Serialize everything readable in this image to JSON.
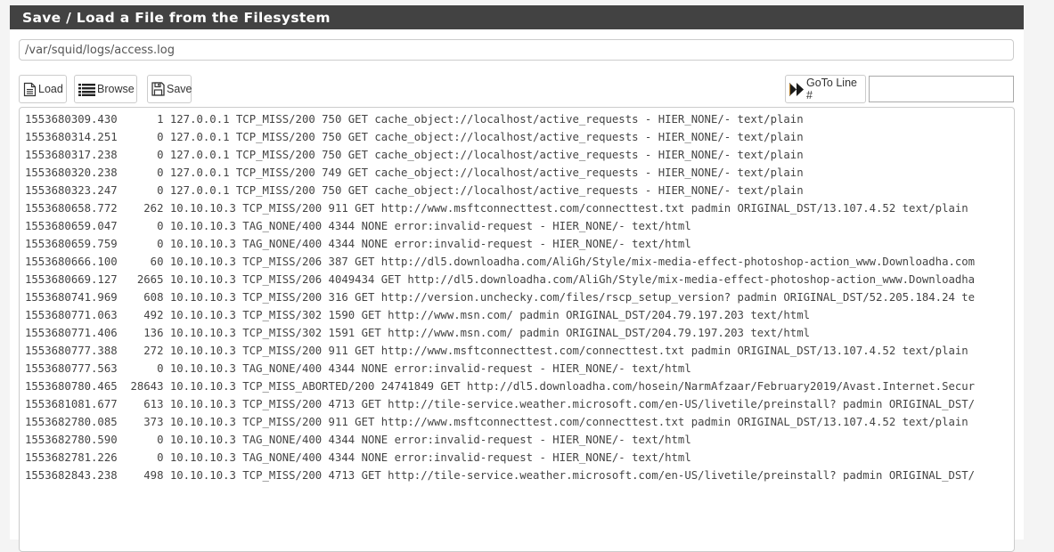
{
  "panel": {
    "title": "Save / Load a File from the Filesystem"
  },
  "file_path": {
    "value": "/var/squid/logs/access.log"
  },
  "toolbar": {
    "load_label": "Load",
    "load_icon": "file-text-icon",
    "browse_label": "Browse",
    "browse_icon": "list-icon",
    "save_label": "Save",
    "save_icon": "floppy-disk-icon",
    "goto_label": "GoTo Line #",
    "goto_icon": "fast-forward-icon",
    "goto_value": ""
  },
  "log_lines": [
    "1553680309.430      1 127.0.0.1 TCP_MISS/200 750 GET cache_object://localhost/active_requests - HIER_NONE/- text/plain",
    "1553680314.251      0 127.0.0.1 TCP_MISS/200 750 GET cache_object://localhost/active_requests - HIER_NONE/- text/plain",
    "1553680317.238      0 127.0.0.1 TCP_MISS/200 750 GET cache_object://localhost/active_requests - HIER_NONE/- text/plain",
    "1553680320.238      0 127.0.0.1 TCP_MISS/200 749 GET cache_object://localhost/active_requests - HIER_NONE/- text/plain",
    "1553680323.247      0 127.0.0.1 TCP_MISS/200 750 GET cache_object://localhost/active_requests - HIER_NONE/- text/plain",
    "1553680658.772    262 10.10.10.3 TCP_MISS/200 911 GET http://www.msftconnecttest.com/connecttest.txt padmin ORIGINAL_DST/13.107.4.52 text/plain",
    "1553680659.047      0 10.10.10.3 TAG_NONE/400 4344 NONE error:invalid-request - HIER_NONE/- text/html",
    "1553680659.759      0 10.10.10.3 TAG_NONE/400 4344 NONE error:invalid-request - HIER_NONE/- text/html",
    "1553680666.100     60 10.10.10.3 TCP_MISS/206 387 GET http://dl5.downloadha.com/AliGh/Style/mix-media-effect-photoshop-action_www.Downloadha.com",
    "1553680669.127   2665 10.10.10.3 TCP_MISS/206 4049434 GET http://dl5.downloadha.com/AliGh/Style/mix-media-effect-photoshop-action_www.Downloadha",
    "1553680741.969    608 10.10.10.3 TCP_MISS/200 316 GET http://version.unchecky.com/files/rscp_setup_version? padmin ORIGINAL_DST/52.205.184.24 te",
    "1553680771.063    492 10.10.10.3 TCP_MISS/302 1590 GET http://www.msn.com/ padmin ORIGINAL_DST/204.79.197.203 text/html",
    "1553680771.406    136 10.10.10.3 TCP_MISS/302 1591 GET http://www.msn.com/ padmin ORIGINAL_DST/204.79.197.203 text/html",
    "1553680777.388    272 10.10.10.3 TCP_MISS/200 911 GET http://www.msftconnecttest.com/connecttest.txt padmin ORIGINAL_DST/13.107.4.52 text/plain",
    "1553680777.563      0 10.10.10.3 TAG_NONE/400 4344 NONE error:invalid-request - HIER_NONE/- text/html",
    "1553680780.465  28643 10.10.10.3 TCP_MISS_ABORTED/200 24741849 GET http://dl5.downloadha.com/hosein/NarmAfzaar/February2019/Avast.Internet.Secur",
    "1553681081.677    613 10.10.10.3 TCP_MISS/200 4713 GET http://tile-service.weather.microsoft.com/en-US/livetile/preinstall? padmin ORIGINAL_DST/",
    "1553682780.085    373 10.10.10.3 TCP_MISS/200 911 GET http://www.msftconnecttest.com/connecttest.txt padmin ORIGINAL_DST/13.107.4.52 text/plain",
    "1553682780.590      0 10.10.10.3 TAG_NONE/400 4344 NONE error:invalid-request - HIER_NONE/- text/html",
    "1553682781.226      0 10.10.10.3 TAG_NONE/400 4344 NONE error:invalid-request - HIER_NONE/- text/html",
    "1553682843.238    498 10.10.10.3 TCP_MISS/200 4713 GET http://tile-service.weather.microsoft.com/en-US/livetile/preinstall? padmin ORIGINAL_DST/"
  ],
  "colors": {
    "header_bg": "#424242",
    "header_text": "#ffffff",
    "goto_icon_color": "#1a1a1a",
    "goto_icon_accent": "#c58a2a"
  }
}
